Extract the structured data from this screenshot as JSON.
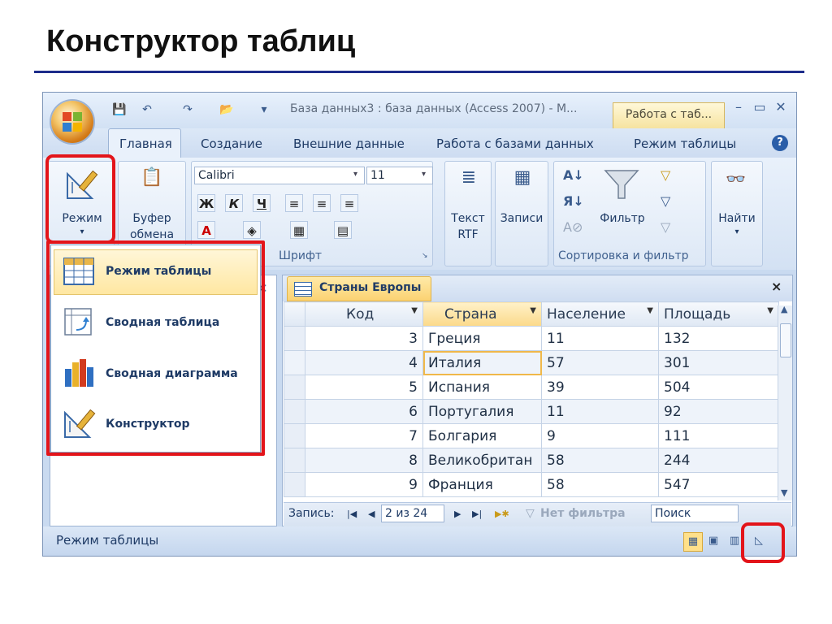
{
  "slide": {
    "title": "Конструктор таблиц"
  },
  "window": {
    "title": "База данных3 : база данных (Access 2007) - М...",
    "context_tab": "Работа с таб...",
    "controls": {
      "minimize": "–",
      "maximize": "▭",
      "close": "✕"
    },
    "tabs": [
      "Главная",
      "Создание",
      "Внешние данные",
      "Работа с базами данных",
      "Режим таблицы"
    ],
    "help": "?"
  },
  "ribbon": {
    "mode_label": "Режим",
    "clipboard_label_1": "Буфер",
    "clipboard_label_2": "обмена",
    "font_name": "Calibri",
    "font_size": "11",
    "bold": "Ж",
    "italic": "К",
    "underline": "Ч",
    "font_group": "Шрифт",
    "rtf_label_1": "Текст",
    "rtf_label_2": "RTF",
    "records_label": "Записи",
    "filter_label": "Фильтр",
    "sort_group": "Сортировка и фильтр",
    "find_label": "Найти"
  },
  "menu": {
    "items": [
      "Режим таблицы",
      "Сводная таблица",
      "Сводная диаграмма",
      "Конструктор"
    ]
  },
  "document": {
    "tab_label": "Страны Европы",
    "close": "×",
    "columns": [
      "Код",
      "Страна",
      "Население",
      "Площадь"
    ],
    "rows": [
      {
        "id": "3",
        "country": "Греция",
        "population": "11",
        "area": "132"
      },
      {
        "id": "4",
        "country": "Италия",
        "population": "57",
        "area": "301"
      },
      {
        "id": "5",
        "country": "Испания",
        "population": "39",
        "area": "504"
      },
      {
        "id": "6",
        "country": "Португалия",
        "population": "11",
        "area": "92"
      },
      {
        "id": "7",
        "country": "Болгария",
        "population": "9",
        "area": "111"
      },
      {
        "id": "8",
        "country": "Великобритан",
        "population": "58",
        "area": "244"
      },
      {
        "id": "9",
        "country": "Франция",
        "population": "58",
        "area": "547"
      }
    ]
  },
  "record_nav": {
    "label": "Запись:",
    "position": "2 из 24",
    "filter": "Нет фильтра",
    "search": "Поиск"
  },
  "status": {
    "text": "Режим таблицы"
  },
  "colors": {
    "highlight": "#e3141a",
    "title_rule": "#1d2c8a"
  }
}
